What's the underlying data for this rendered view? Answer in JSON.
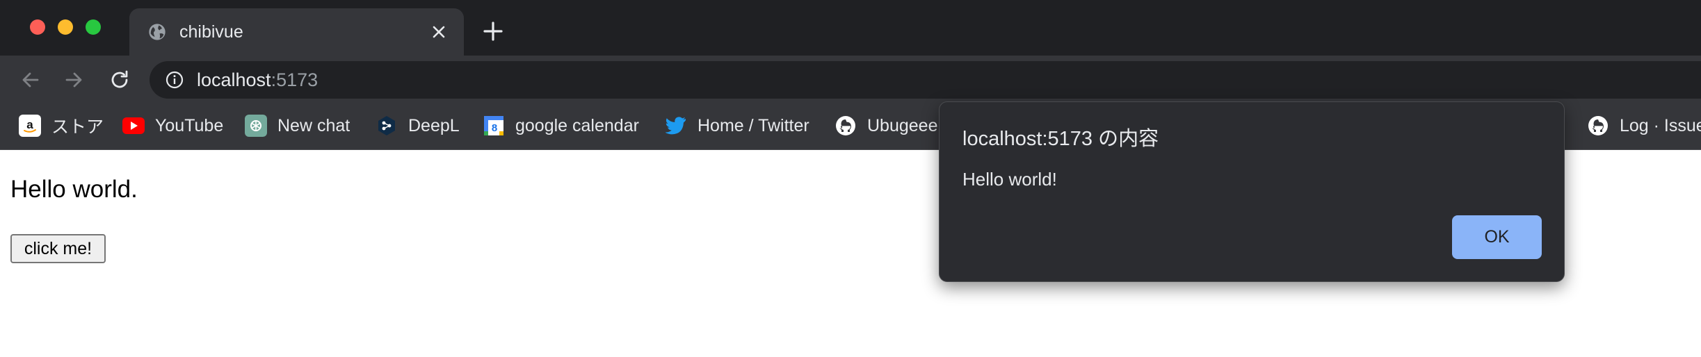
{
  "browser": {
    "window_controls": [
      "close",
      "minimize",
      "maximize"
    ],
    "tab": {
      "title": "chibivue",
      "favicon": "globe-icon"
    },
    "toolbar": {
      "url_host": "localhost",
      "url_port": ":5173"
    },
    "bookmarks": [
      {
        "label": "ストア",
        "icon": "amazon-icon",
        "color": "#ffffff"
      },
      {
        "label": "YouTube",
        "icon": "youtube-icon",
        "color": "#ff0000"
      },
      {
        "label": "New chat",
        "icon": "chatgpt-icon",
        "color": "#74aa9c"
      },
      {
        "label": "DeepL",
        "icon": "deepl-icon",
        "color": "#0f2b46"
      },
      {
        "label": "google calendar",
        "icon": "google-calendar-icon",
        "color": "#4285f4"
      },
      {
        "label": "Home / Twitter",
        "icon": "twitter-icon",
        "color": "#1d9bf0"
      },
      {
        "label": "Ubugeee",
        "icon": "github-icon",
        "color": "#ffffff"
      },
      {
        "label": "Log · Issue",
        "icon": "github-icon",
        "color": "#ffffff"
      }
    ]
  },
  "page": {
    "heading": "Hello world.",
    "button_label": "click me!"
  },
  "dialog": {
    "title": "localhost:5173 の内容",
    "message": "Hello world!",
    "ok_label": "OK",
    "accent": "#8ab4f8"
  }
}
